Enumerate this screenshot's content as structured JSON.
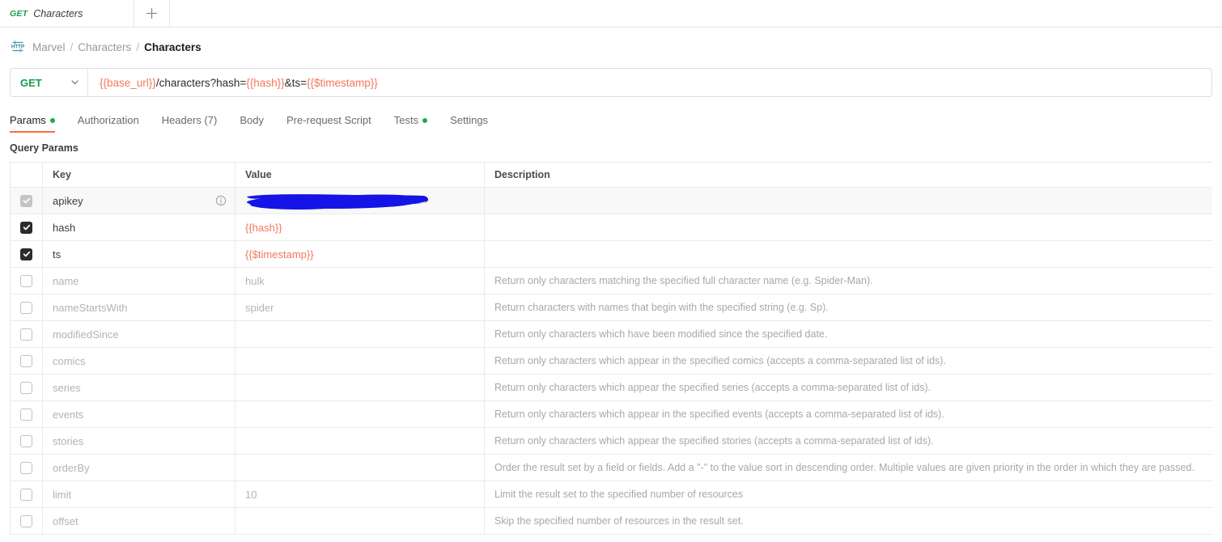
{
  "tabbar": {
    "request_tab": {
      "method": "GET",
      "name": "Characters"
    },
    "new_tab_label": "+"
  },
  "breadcrumb": {
    "icon": "http-icon",
    "items": [
      {
        "label": "Marvel",
        "current": false
      },
      {
        "label": "Characters",
        "current": false
      },
      {
        "label": "Characters",
        "current": true
      }
    ],
    "separator": "/"
  },
  "url_bar": {
    "method": "GET",
    "method_caret_icon": "chevron-down-icon",
    "url_segments": [
      {
        "text": "{{base_url}}",
        "kind": "var"
      },
      {
        "text": "/characters?hash=",
        "kind": "plain"
      },
      {
        "text": "{{hash}}",
        "kind": "var"
      },
      {
        "text": "&ts=",
        "kind": "plain"
      },
      {
        "text": "{{$timestamp}}",
        "kind": "var"
      }
    ],
    "url_plain": "{{base_url}}/characters?hash={{hash}}&ts={{$timestamp}}"
  },
  "subtabs": [
    {
      "label": "Params",
      "dot": true,
      "active": true
    },
    {
      "label": "Authorization",
      "dot": false,
      "active": false
    },
    {
      "label": "Headers (7)",
      "dot": false,
      "active": false
    },
    {
      "label": "Body",
      "dot": false,
      "active": false
    },
    {
      "label": "Pre-request Script",
      "dot": false,
      "active": false
    },
    {
      "label": "Tests",
      "dot": true,
      "active": false
    },
    {
      "label": "Settings",
      "dot": false,
      "active": false
    }
  ],
  "params": {
    "section_title": "Query Params",
    "columns": {
      "key": "Key",
      "value": "Value",
      "description": "Description"
    },
    "rows": [
      {
        "checked": true,
        "checkbox_style": "muted",
        "hovered": true,
        "key": "apikey",
        "has_info_icon": true,
        "value": "",
        "redacted": true,
        "description": ""
      },
      {
        "checked": true,
        "checkbox_style": "on",
        "hovered": false,
        "key": "hash",
        "has_info_icon": false,
        "value": "{{hash}}",
        "value_is_var": true,
        "redacted": false,
        "description": ""
      },
      {
        "checked": true,
        "checkbox_style": "on",
        "hovered": false,
        "key": "ts",
        "has_info_icon": false,
        "value": "{{$timestamp}}",
        "value_is_var": true,
        "redacted": false,
        "description": ""
      },
      {
        "checked": false,
        "checkbox_style": "off",
        "hovered": false,
        "key": "name",
        "has_info_icon": false,
        "value": "hulk",
        "redacted": false,
        "description": "Return only characters matching the specified full character name (e.g. Spider-Man)."
      },
      {
        "checked": false,
        "checkbox_style": "off",
        "hovered": false,
        "key": "nameStartsWith",
        "has_info_icon": false,
        "value": "spider",
        "redacted": false,
        "description": "Return characters with names that begin with the specified string (e.g. Sp)."
      },
      {
        "checked": false,
        "checkbox_style": "off",
        "hovered": false,
        "key": "modifiedSince",
        "has_info_icon": false,
        "value": "",
        "redacted": false,
        "description": "Return only characters which have been modified since the specified date."
      },
      {
        "checked": false,
        "checkbox_style": "off",
        "hovered": false,
        "key": "comics",
        "has_info_icon": false,
        "value": "",
        "redacted": false,
        "description": "Return only characters which appear in the specified comics (accepts a comma-separated list of ids)."
      },
      {
        "checked": false,
        "checkbox_style": "off",
        "hovered": false,
        "key": "series",
        "has_info_icon": false,
        "value": "",
        "redacted": false,
        "description": "Return only characters which appear the specified series (accepts a comma-separated list of ids)."
      },
      {
        "checked": false,
        "checkbox_style": "off",
        "hovered": false,
        "key": "events",
        "has_info_icon": false,
        "value": "",
        "redacted": false,
        "description": "Return only characters which appear in the specified events (accepts a comma-separated list of ids)."
      },
      {
        "checked": false,
        "checkbox_style": "off",
        "hovered": false,
        "key": "stories",
        "has_info_icon": false,
        "value": "",
        "redacted": false,
        "description": "Return only characters which appear the specified stories (accepts a comma-separated list of ids)."
      },
      {
        "checked": false,
        "checkbox_style": "off",
        "hovered": false,
        "key": "orderBy",
        "has_info_icon": false,
        "value": "",
        "redacted": false,
        "description": "Order the result set by a field or fields. Add a \"-\" to the value sort in descending order. Multiple values are given priority in the order in which they are passed."
      },
      {
        "checked": false,
        "checkbox_style": "off",
        "hovered": false,
        "key": "limit",
        "has_info_icon": false,
        "value": "10",
        "redacted": false,
        "description": "Limit the result set to the specified number of resources"
      },
      {
        "checked": false,
        "checkbox_style": "off",
        "hovered": false,
        "key": "offset",
        "has_info_icon": false,
        "value": "",
        "redacted": false,
        "description": "Skip the specified number of resources in the result set."
      }
    ]
  },
  "colors": {
    "accent_orange": "#ff6c37",
    "method_green": "#1a9a52",
    "variable_orange": "#f4775c",
    "status_dot_green": "#1faa52",
    "redaction_blue": "#1414e6",
    "http_icon_teal": "#3a9aa8"
  }
}
